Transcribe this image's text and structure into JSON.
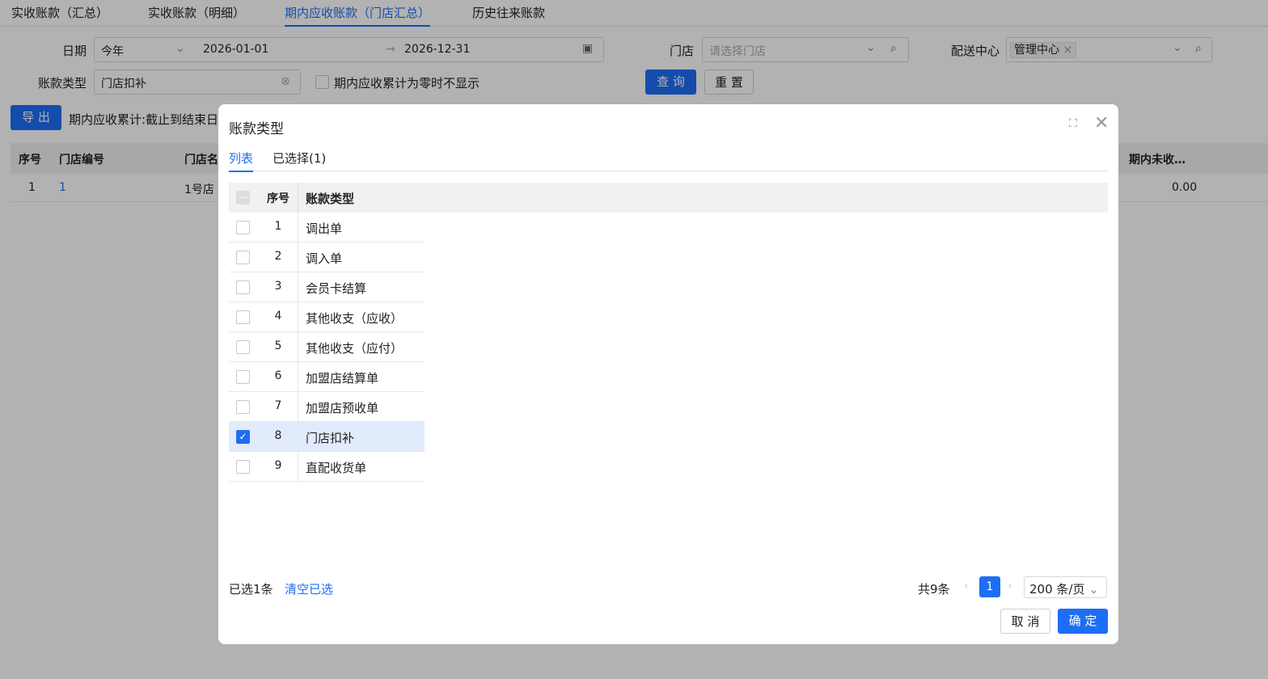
{
  "tabs": [
    "实收账款（汇总）",
    "实收账款（明细）",
    "期内应收账款（门店汇总）",
    "历史往来账款"
  ],
  "filters": {
    "date_label": "日期",
    "date_preset": "今年",
    "date_start": "2026-01-01",
    "date_end": "2026-12-31",
    "store_label": "门店",
    "store_placeholder": "请选择门店",
    "dc_label": "配送中心",
    "dc_tag": "管理中心",
    "type_label": "账款类型",
    "type_value": "门店扣补",
    "hide_zero_label": "期内应收累计为零时不显示",
    "query": "查 询",
    "reset": "重 置"
  },
  "toolbar": {
    "export": "导 出",
    "note": "期内应收累计:截止到结束日"
  },
  "table": {
    "headers": {
      "seq": "序号",
      "store_no": "门店编号",
      "store_name": "门店名",
      "uncollected": "期内未收…"
    },
    "row": {
      "seq": "1",
      "store_no": "1",
      "store_name": "1号店",
      "uncollected": "0.00"
    }
  },
  "modal": {
    "title": "账款类型",
    "tab_list": "列表",
    "tab_selected": "已选择(1)",
    "col_seq": "序号",
    "col_type": "账款类型",
    "rows": [
      {
        "n": "1",
        "name": "调出单",
        "checked": false
      },
      {
        "n": "2",
        "name": "调入单",
        "checked": false
      },
      {
        "n": "3",
        "name": "会员卡结算",
        "checked": false
      },
      {
        "n": "4",
        "name": "其他收支（应收）",
        "checked": false
      },
      {
        "n": "5",
        "name": "其他收支（应付）",
        "checked": false
      },
      {
        "n": "6",
        "name": "加盟店结算单",
        "checked": false
      },
      {
        "n": "7",
        "name": "加盟店预收单",
        "checked": false
      },
      {
        "n": "8",
        "name": "门店扣补",
        "checked": true
      },
      {
        "n": "9",
        "name": "直配收货单",
        "checked": false
      }
    ],
    "selected_count": "已选1条",
    "clear": "清空已选",
    "total": "共9条",
    "page": "1",
    "page_size": "200 条/页",
    "cancel": "取 消",
    "ok": "确 定"
  },
  "colors": {
    "accent": "#1d6ef5"
  }
}
